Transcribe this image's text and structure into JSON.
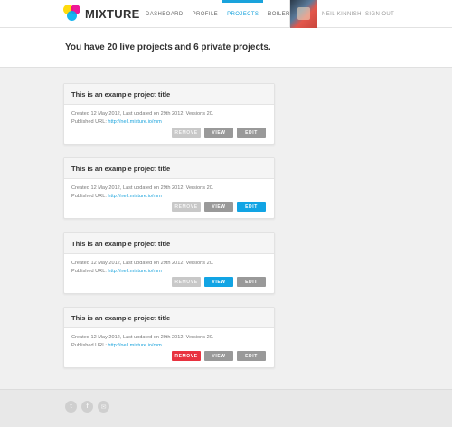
{
  "header": {
    "brand": "MIXTURE",
    "nav": [
      "DASHBOARD",
      "PROFILE",
      "PROJECTS",
      "BOILERPLATES"
    ],
    "active_nav": "PROJECTS",
    "user_name": "NEIL KINNISH",
    "sign_out": "SIGN OUT",
    "accent_color": "#1aa3dc"
  },
  "summary": "You have 20 live projects and 6 private projects.",
  "projects": [
    {
      "title": "This is an example project title",
      "meta": "Created 12 May 2012, Last updated on 29th 2012. Versions 20.",
      "published_label": "Published URL: ",
      "url": "http://neil.mixture.io/mm",
      "remove": "REMOVE",
      "view": "VIEW",
      "edit": "EDIT",
      "state": {
        "remove": "disabled",
        "view": "gray",
        "edit": "gray"
      }
    },
    {
      "title": "This is an example project title",
      "meta": "Created 12 May 2012, Last updated on 29th 2012. Versions 20.",
      "published_label": "Published URL: ",
      "url": "http://neil.mixture.io/mm",
      "remove": "REMOVE",
      "view": "VIEW",
      "edit": "EDIT",
      "state": {
        "remove": "disabled",
        "view": "gray",
        "edit": "blue"
      }
    },
    {
      "title": "This is an example project title",
      "meta": "Created 12 May 2012, Last updated on 29th 2012. Versions 20.",
      "published_label": "Published URL: ",
      "url": "http://neil.mixture.io/mm",
      "remove": "REMOVE",
      "view": "VIEW",
      "edit": "EDIT",
      "state": {
        "remove": "disabled",
        "view": "blue",
        "edit": "gray"
      }
    },
    {
      "title": "This is an example project title",
      "meta": "Created 12 May 2012, Last updated on 29th 2012. Versions 20.",
      "published_label": "Published URL: ",
      "url": "http://neil.mixture.io/mm",
      "remove": "REMOVE",
      "view": "VIEW",
      "edit": "EDIT",
      "state": {
        "remove": "danger",
        "view": "gray",
        "edit": "gray"
      }
    }
  ],
  "footer": {
    "social": [
      {
        "icon": "twitter-icon",
        "glyph": "t"
      },
      {
        "icon": "facebook-icon",
        "glyph": "f"
      },
      {
        "icon": "email-icon",
        "glyph": "✉"
      }
    ]
  }
}
